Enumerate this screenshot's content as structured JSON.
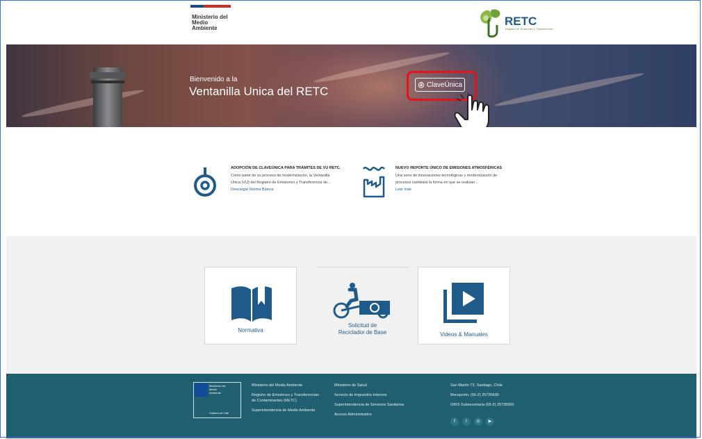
{
  "header": {
    "ministry_line1": "Ministerio del",
    "ministry_line2": "Medio",
    "ministry_line3": "Ambiente",
    "logo_text": "RETC",
    "logo_subtitle": "Registro de Emisiones y Transferencia"
  },
  "hero": {
    "welcome": "Bienvenido a la",
    "title": "Ventanilla Unica del RETC",
    "login_button": "ClaveÚnica",
    "login_icon": "claveunica-icon",
    "highlight_color": "#e3141b"
  },
  "news": [
    {
      "icon": "claveunica-icon",
      "title": "ADOPCIÓN DE CLAVEÚNICA PARA TRÁMITES DE VU RETC.",
      "body_line1": "Como parte de su proceso de modernización, la Ventanilla",
      "body_line2": "Única (VU) del Registro de Emisiones y Transferencia de...",
      "link": "Descargar Norma Básica"
    },
    {
      "icon": "factory-icon",
      "title": "NUEVO REPORTE ÚNICO DE EMISIONES ATMOSFÉRICAS",
      "body_line1": "Una serie de innovaciones tecnológicas y modernización de",
      "body_line2": "procesos cambiará la forma en que se realizan...",
      "link": "Leer más"
    }
  ],
  "services": [
    {
      "label": "Normativa",
      "icon": "book-icon"
    },
    {
      "label_line1": "Solicitud de",
      "label_line2": "Reciclador de Base",
      "icon": "recycler-cart-icon"
    },
    {
      "label": "Videos & Manuales",
      "icon": "video-play-icon"
    }
  ],
  "footer": {
    "gob_label1": "Ministerio del",
    "gob_label2": "Medio",
    "gob_label3": "Ambiente",
    "gob_bottom": "Gobierno de Chile",
    "col1": [
      "Ministerio del Medio Ambiente",
      "Registro de Emisiones y Transferencias",
      "de Contaminantes (RETC)",
      "Superintendencia de Medio Ambiente"
    ],
    "col2": [
      "Ministerio de Salud",
      "Servicio de Impuestos Internos",
      "Superintendencia de Servicios Sanitarios",
      "Acceso Administrativo"
    ],
    "col3": [
      "San Martín 73, Santiago, Chile",
      "Recepción: (56-2) 25735600",
      "OIRS Subsecretaría (56-2) 25735600"
    ],
    "social": [
      {
        "label": "f",
        "icon": "facebook-icon"
      },
      {
        "label": "t",
        "icon": "twitter-icon"
      },
      {
        "label": "◎",
        "icon": "instagram-icon"
      },
      {
        "label": "▶",
        "icon": "youtube-icon"
      }
    ],
    "bg_color": "#1f5f6f"
  },
  "colors": {
    "brand_blue": "#1f5b8a",
    "footer": "#1f5f6f"
  }
}
